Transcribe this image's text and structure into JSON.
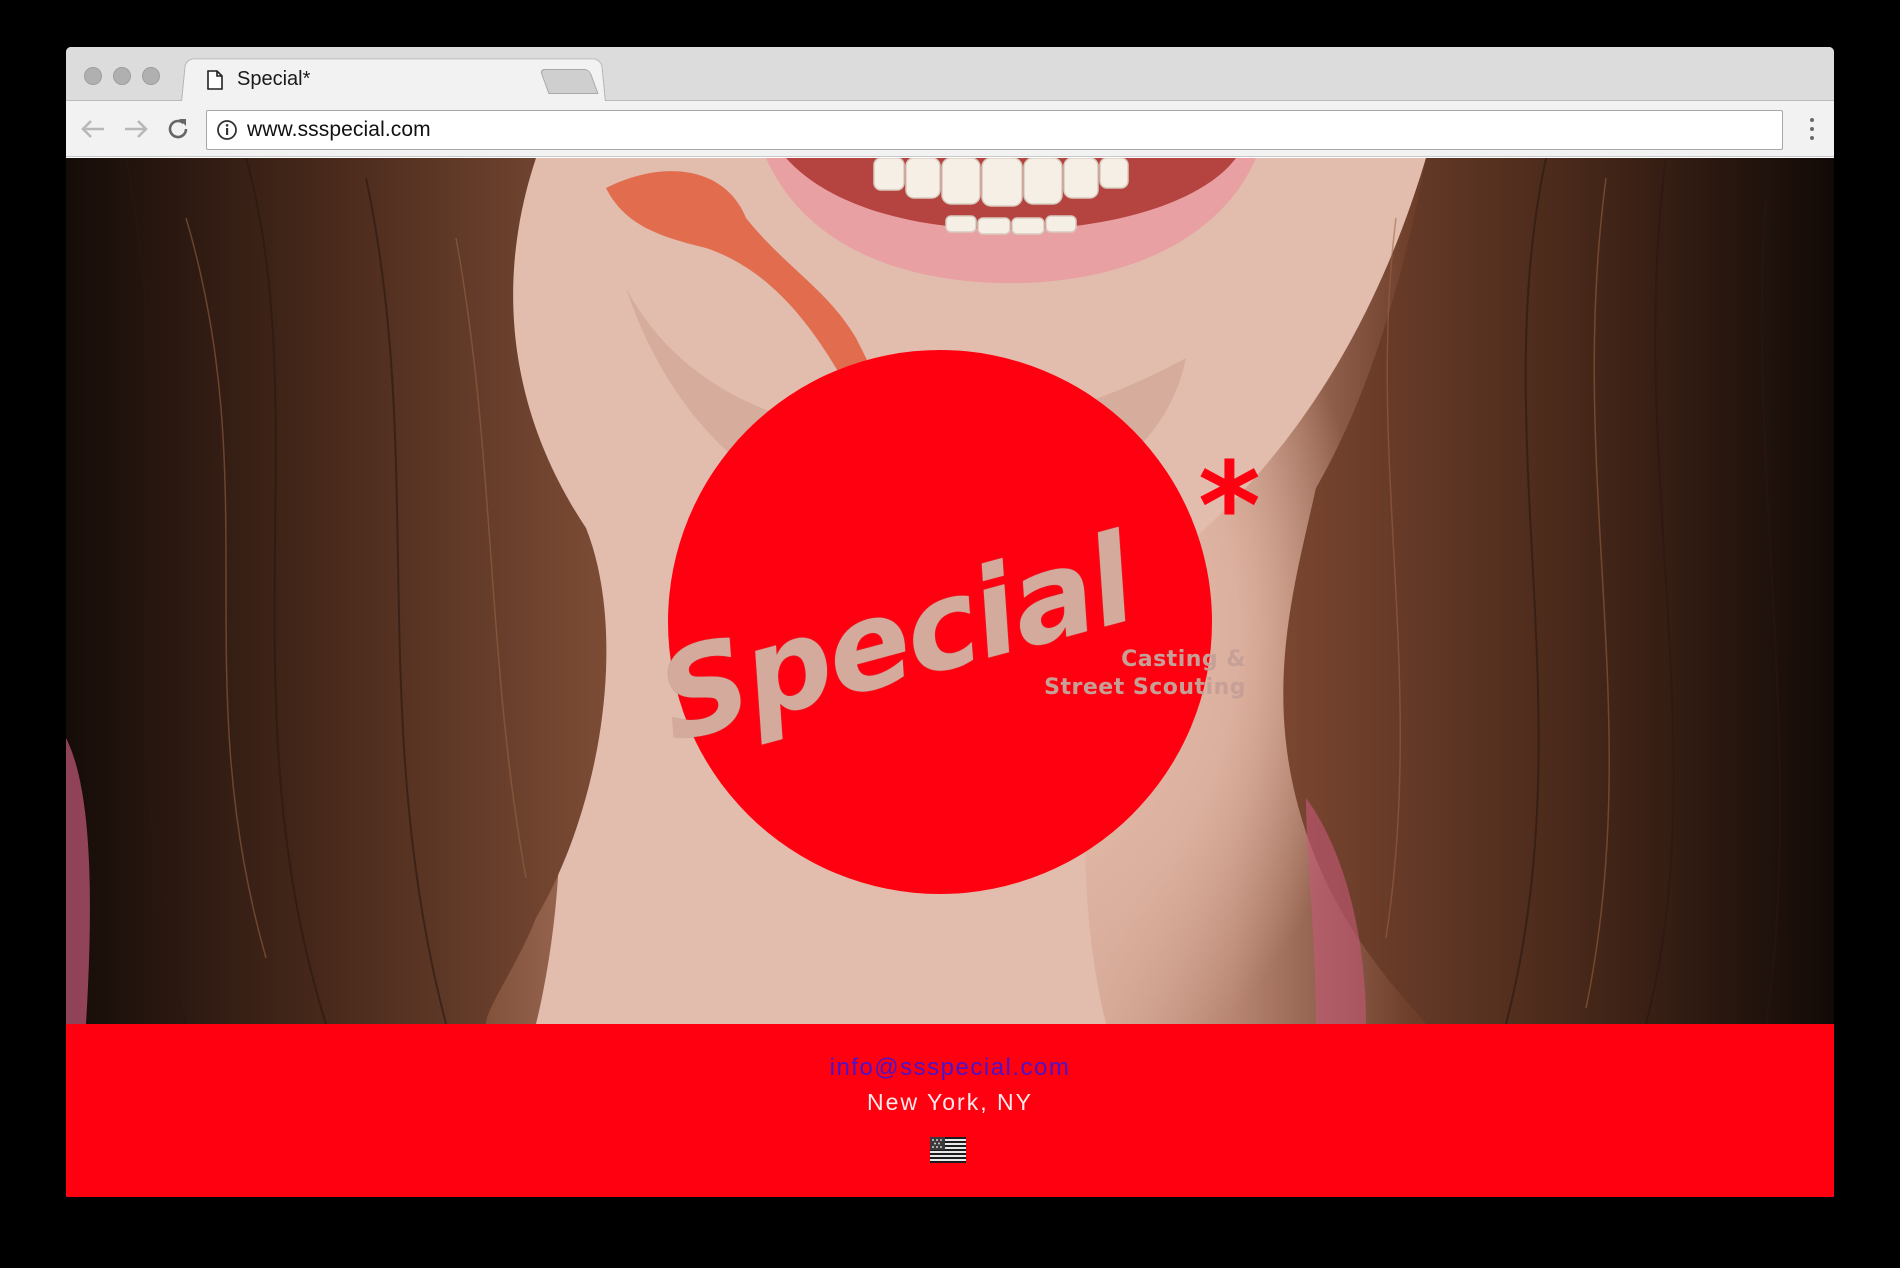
{
  "browser": {
    "tab_title": "Special*",
    "tab_close": "×",
    "url": "www.ssspecial.com"
  },
  "logo": {
    "word": "Special",
    "asterisk": "*",
    "tagline_line1": "Casting &",
    "tagline_line2": "Street Scouting"
  },
  "footer": {
    "email": "info@ssspecial.com",
    "location": "New York, NY"
  },
  "colors": {
    "brand_red": "#ff0011",
    "email_link": "#4b14c8"
  },
  "icons": [
    "page-icon",
    "back-arrow-icon",
    "forward-arrow-icon",
    "reload-icon",
    "info-icon",
    "menu-icon",
    "us-flag-icon"
  ]
}
